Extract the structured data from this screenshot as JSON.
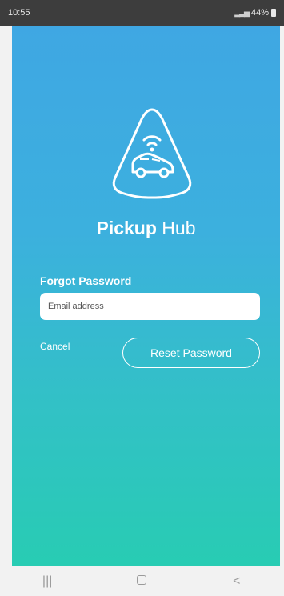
{
  "status_bar": {
    "time": "10:55",
    "battery": "44%"
  },
  "app": {
    "title_bold": "Pickup",
    "title_rest": "Hub"
  },
  "form": {
    "label": "Forgot Password",
    "email_placeholder": "Email address",
    "cancel_label": "Cancel",
    "reset_label": "Reset Password"
  },
  "nav": {
    "recent": "|||",
    "back": "<"
  },
  "colors": {
    "gradient_top": "#3fa7e3",
    "gradient_bottom": "#28ccb3",
    "white": "#ffffff"
  },
  "icons": [
    "car-wifi-logo-icon",
    "battery-icon",
    "signal-icon",
    "home-icon"
  ]
}
